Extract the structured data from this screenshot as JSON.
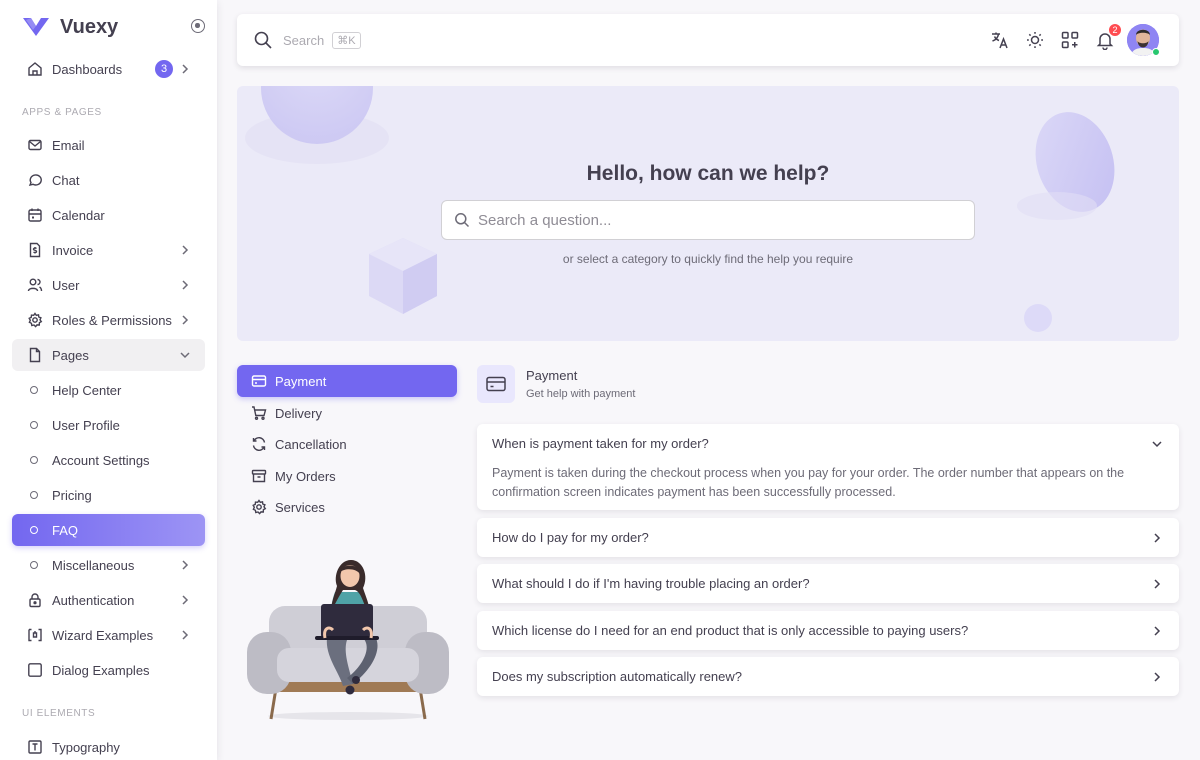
{
  "brand": {
    "name": "Vuexy",
    "accent": "#7367f0"
  },
  "sidebar": {
    "dashboards": {
      "label": "Dashboards",
      "badge": "3"
    },
    "section_apps": "APPS & PAGES",
    "apps": [
      {
        "label": "Email",
        "icon": "mail-icon"
      },
      {
        "label": "Chat",
        "icon": "chat-icon"
      },
      {
        "label": "Calendar",
        "icon": "calendar-icon"
      },
      {
        "label": "Invoice",
        "icon": "invoice-icon"
      },
      {
        "label": "User",
        "icon": "users-icon"
      },
      {
        "label": "Roles & Permissions",
        "icon": "settings-icon"
      },
      {
        "label": "Pages",
        "icon": "file-icon"
      }
    ],
    "pages_sub": [
      {
        "label": "Help Center"
      },
      {
        "label": "User Profile"
      },
      {
        "label": "Account Settings"
      },
      {
        "label": "Pricing"
      },
      {
        "label": "FAQ",
        "active": true
      },
      {
        "label": "Miscellaneous"
      }
    ],
    "more": [
      {
        "label": "Authentication",
        "icon": "lock-icon"
      },
      {
        "label": "Wizard Examples",
        "icon": "wizard-icon"
      },
      {
        "label": "Dialog Examples",
        "icon": "square-icon"
      }
    ],
    "section_ui": "UI ELEMENTS",
    "ui": [
      {
        "label": "Typography",
        "icon": "typography-icon"
      }
    ]
  },
  "navbar": {
    "search_label": "Search",
    "search_shortcut": "⌘K",
    "notifications_count": "2"
  },
  "hero": {
    "title": "Hello, how can we help?",
    "search_placeholder": "Search a question...",
    "subtitle": "or select a category to quickly find the help you require"
  },
  "categories": [
    {
      "label": "Payment",
      "icon": "credit-card-icon",
      "active": true
    },
    {
      "label": "Delivery",
      "icon": "cart-icon"
    },
    {
      "label": "Cancellation",
      "icon": "refresh-icon"
    },
    {
      "label": "My Orders",
      "icon": "archive-icon"
    },
    {
      "label": "Services",
      "icon": "settings-icon"
    }
  ],
  "faq": {
    "title": "Payment",
    "subtitle": "Get help with payment",
    "items": [
      {
        "question": "When is payment taken for my order?",
        "answer": "Payment is taken during the checkout process when you pay for your order. The order number that appears on the confirmation screen indicates payment has been successfully processed.",
        "expanded": true
      },
      {
        "question": "How do I pay for my order?"
      },
      {
        "question": "What should I do if I'm having trouble placing an order?"
      },
      {
        "question": "Which license do I need for an end product that is only accessible to paying users?"
      },
      {
        "question": "Does my subscription automatically renew?"
      }
    ]
  }
}
